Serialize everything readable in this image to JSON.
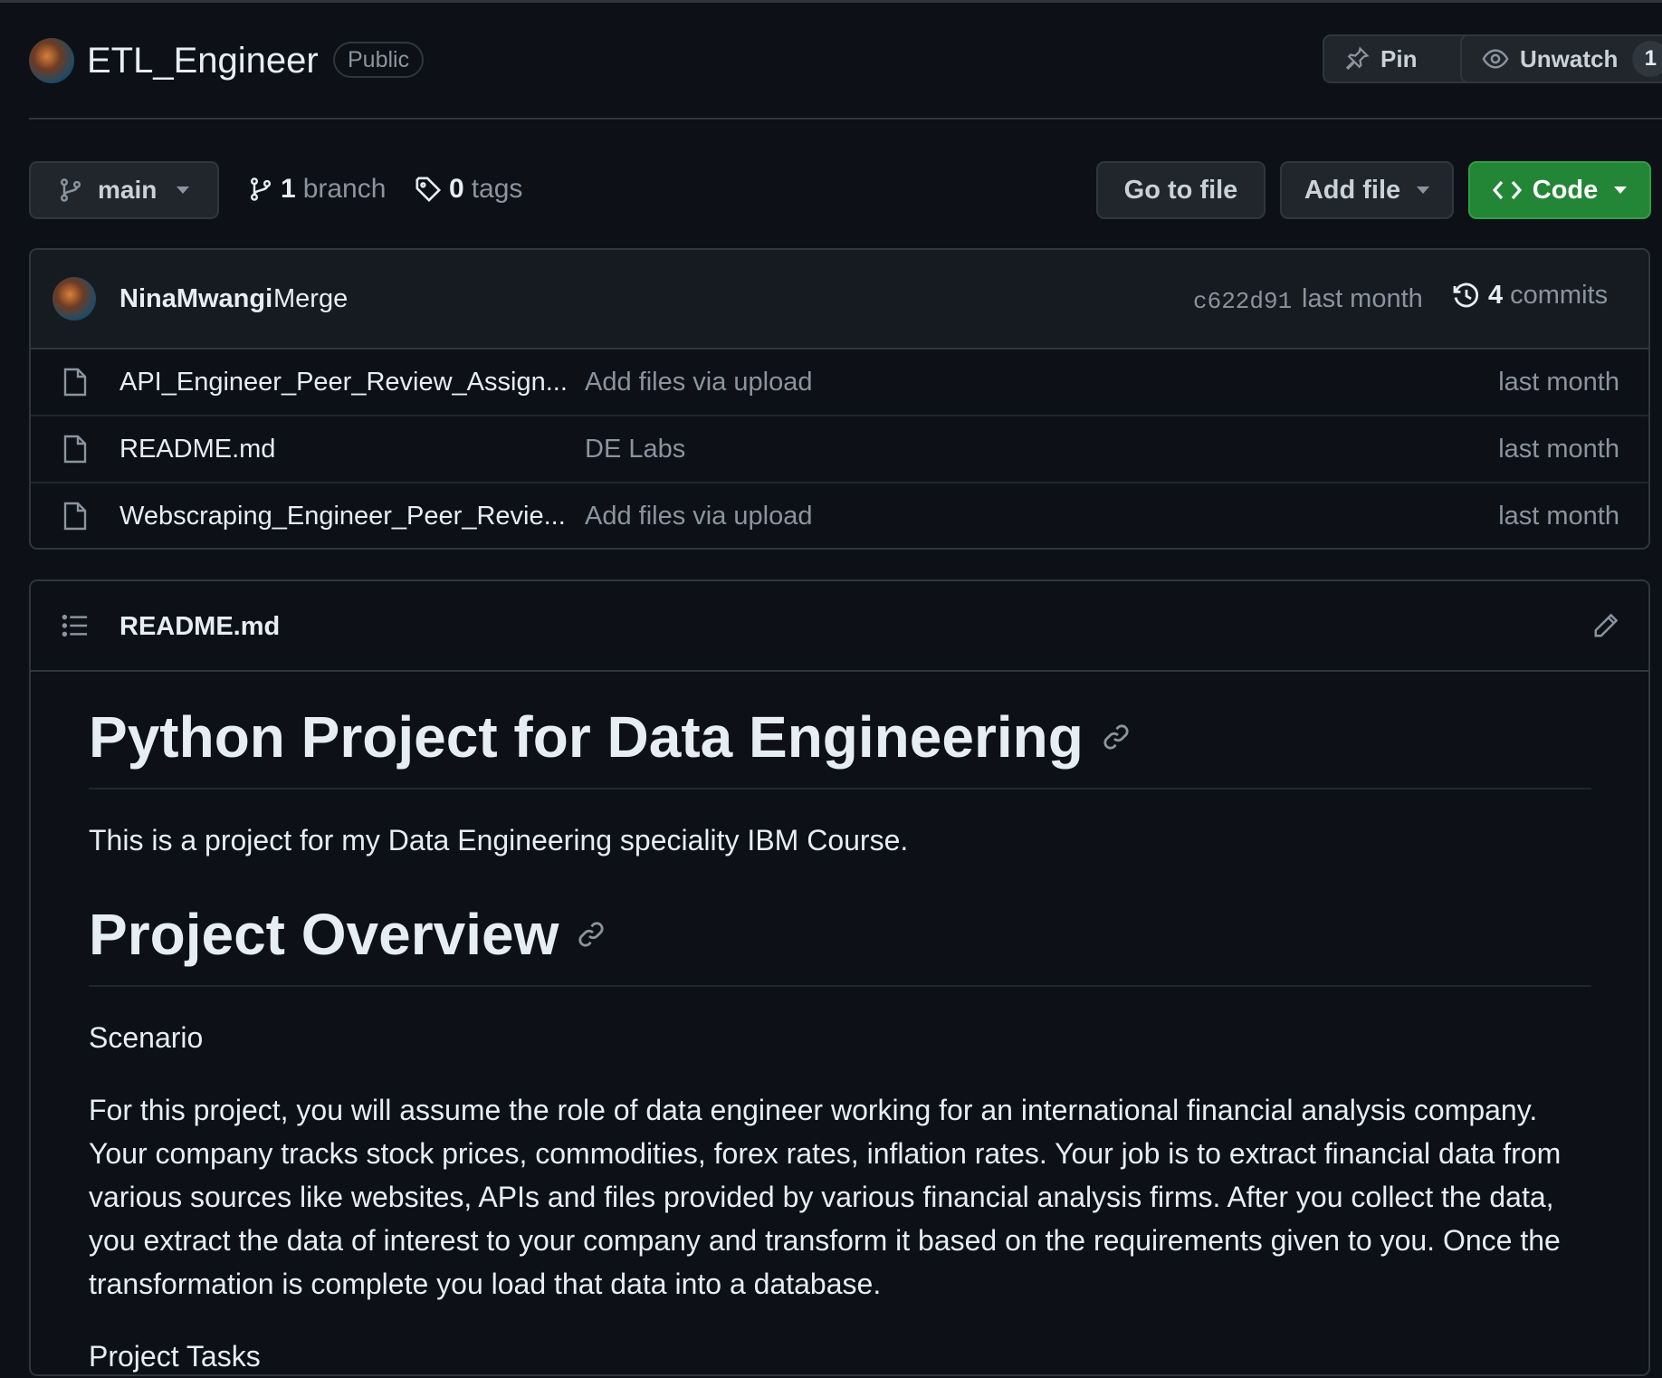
{
  "repo": {
    "name": "ETL_Engineer",
    "visibility": "Public",
    "pin_label": "Pin",
    "watch_label": "Unwatch",
    "watch_count": "1"
  },
  "branch_bar": {
    "branch_name": "main",
    "branch_count": "1",
    "branch_label": "branch",
    "tag_count": "0",
    "tag_label": "tags",
    "goto_file": "Go to file",
    "add_file": "Add file",
    "code": "Code"
  },
  "latest_commit": {
    "author": "NinaMwangi",
    "message": "Merge",
    "sha": "c622d91",
    "time": "last month",
    "commit_count": "4",
    "commit_label": "commits"
  },
  "files": [
    {
      "name": "API_Engineer_Peer_Review_Assign...",
      "message": "Add files via upload",
      "time": "last month"
    },
    {
      "name": "README.md",
      "message": "DE Labs",
      "time": "last month"
    },
    {
      "name": "Webscraping_Engineer_Peer_Revie...",
      "message": "Add files via upload",
      "time": "last month"
    }
  ],
  "readme": {
    "filename": "README.md",
    "heading1": "Python Project for Data Engineering",
    "intro": "This is a project for my Data Engineering speciality IBM Course.",
    "heading2": "Project Overview",
    "scenario_label": "Scenario",
    "scenario_text": "For this project, you will assume the role of data engineer working for an international financial analysis company. Your company tracks stock prices, commodities, forex rates, inflation rates. Your job is to extract financial data from various sources like websites, APIs and files provided by various financial analysis firms. After you collect the data, you extract the data of interest to your company and transform it based on the requirements given to you. Once the transformation is complete you load that data into a database.",
    "next_label": "Project Tasks"
  },
  "colors": {
    "background": "#0d1117",
    "code_button": "#238636",
    "border": "#30363d",
    "muted_text": "#8b949e"
  }
}
